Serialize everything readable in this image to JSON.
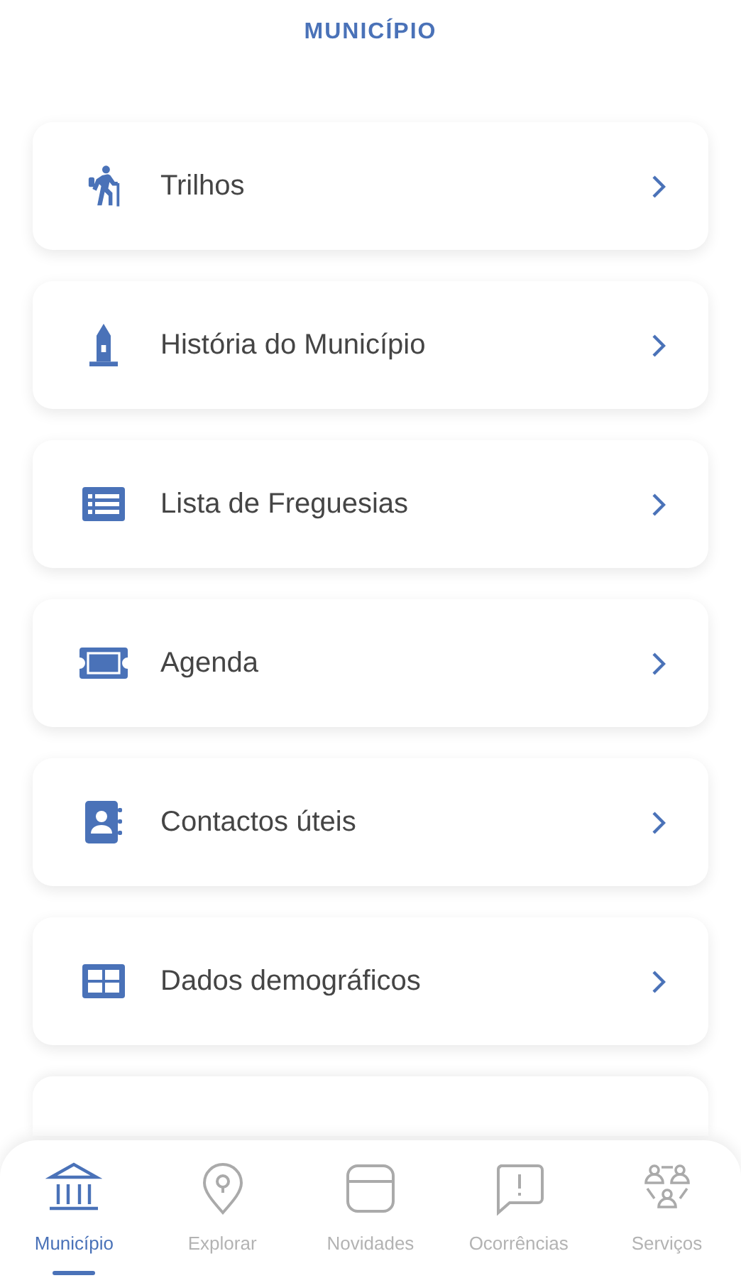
{
  "header": {
    "title": "MUNICÍPIO"
  },
  "menu_items": [
    {
      "label": "Trilhos"
    },
    {
      "label": "História do Município"
    },
    {
      "label": "Lista de Freguesias"
    },
    {
      "label": "Agenda"
    },
    {
      "label": "Contactos úteis"
    },
    {
      "label": "Dados demográficos"
    }
  ],
  "tab_bar": [
    {
      "label": "Município",
      "selected": true
    },
    {
      "label": "Explorar",
      "selected": false
    },
    {
      "label": "Novidades",
      "selected": false
    },
    {
      "label": "Ocorrências",
      "selected": false
    },
    {
      "label": "Serviços",
      "selected": false
    }
  ]
}
